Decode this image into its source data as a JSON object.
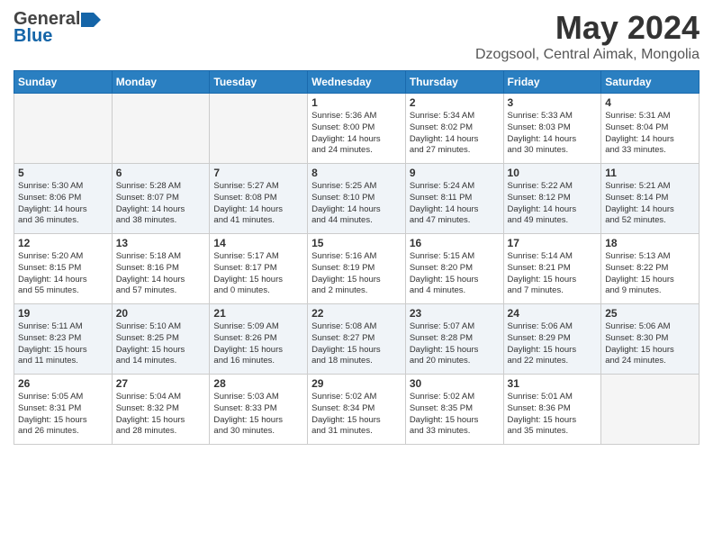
{
  "header": {
    "logo_general": "General",
    "logo_blue": "Blue",
    "month_title": "May 2024",
    "subtitle": "Dzogsool, Central Aimak, Mongolia"
  },
  "weekdays": [
    "Sunday",
    "Monday",
    "Tuesday",
    "Wednesday",
    "Thursday",
    "Friday",
    "Saturday"
  ],
  "weeks": [
    [
      {
        "day": "",
        "info": ""
      },
      {
        "day": "",
        "info": ""
      },
      {
        "day": "",
        "info": ""
      },
      {
        "day": "1",
        "info": "Sunrise: 5:36 AM\nSunset: 8:00 PM\nDaylight: 14 hours\nand 24 minutes."
      },
      {
        "day": "2",
        "info": "Sunrise: 5:34 AM\nSunset: 8:02 PM\nDaylight: 14 hours\nand 27 minutes."
      },
      {
        "day": "3",
        "info": "Sunrise: 5:33 AM\nSunset: 8:03 PM\nDaylight: 14 hours\nand 30 minutes."
      },
      {
        "day": "4",
        "info": "Sunrise: 5:31 AM\nSunset: 8:04 PM\nDaylight: 14 hours\nand 33 minutes."
      }
    ],
    [
      {
        "day": "5",
        "info": "Sunrise: 5:30 AM\nSunset: 8:06 PM\nDaylight: 14 hours\nand 36 minutes."
      },
      {
        "day": "6",
        "info": "Sunrise: 5:28 AM\nSunset: 8:07 PM\nDaylight: 14 hours\nand 38 minutes."
      },
      {
        "day": "7",
        "info": "Sunrise: 5:27 AM\nSunset: 8:08 PM\nDaylight: 14 hours\nand 41 minutes."
      },
      {
        "day": "8",
        "info": "Sunrise: 5:25 AM\nSunset: 8:10 PM\nDaylight: 14 hours\nand 44 minutes."
      },
      {
        "day": "9",
        "info": "Sunrise: 5:24 AM\nSunset: 8:11 PM\nDaylight: 14 hours\nand 47 minutes."
      },
      {
        "day": "10",
        "info": "Sunrise: 5:22 AM\nSunset: 8:12 PM\nDaylight: 14 hours\nand 49 minutes."
      },
      {
        "day": "11",
        "info": "Sunrise: 5:21 AM\nSunset: 8:14 PM\nDaylight: 14 hours\nand 52 minutes."
      }
    ],
    [
      {
        "day": "12",
        "info": "Sunrise: 5:20 AM\nSunset: 8:15 PM\nDaylight: 14 hours\nand 55 minutes."
      },
      {
        "day": "13",
        "info": "Sunrise: 5:18 AM\nSunset: 8:16 PM\nDaylight: 14 hours\nand 57 minutes."
      },
      {
        "day": "14",
        "info": "Sunrise: 5:17 AM\nSunset: 8:17 PM\nDaylight: 15 hours\nand 0 minutes."
      },
      {
        "day": "15",
        "info": "Sunrise: 5:16 AM\nSunset: 8:19 PM\nDaylight: 15 hours\nand 2 minutes."
      },
      {
        "day": "16",
        "info": "Sunrise: 5:15 AM\nSunset: 8:20 PM\nDaylight: 15 hours\nand 4 minutes."
      },
      {
        "day": "17",
        "info": "Sunrise: 5:14 AM\nSunset: 8:21 PM\nDaylight: 15 hours\nand 7 minutes."
      },
      {
        "day": "18",
        "info": "Sunrise: 5:13 AM\nSunset: 8:22 PM\nDaylight: 15 hours\nand 9 minutes."
      }
    ],
    [
      {
        "day": "19",
        "info": "Sunrise: 5:11 AM\nSunset: 8:23 PM\nDaylight: 15 hours\nand 11 minutes."
      },
      {
        "day": "20",
        "info": "Sunrise: 5:10 AM\nSunset: 8:25 PM\nDaylight: 15 hours\nand 14 minutes."
      },
      {
        "day": "21",
        "info": "Sunrise: 5:09 AM\nSunset: 8:26 PM\nDaylight: 15 hours\nand 16 minutes."
      },
      {
        "day": "22",
        "info": "Sunrise: 5:08 AM\nSunset: 8:27 PM\nDaylight: 15 hours\nand 18 minutes."
      },
      {
        "day": "23",
        "info": "Sunrise: 5:07 AM\nSunset: 8:28 PM\nDaylight: 15 hours\nand 20 minutes."
      },
      {
        "day": "24",
        "info": "Sunrise: 5:06 AM\nSunset: 8:29 PM\nDaylight: 15 hours\nand 22 minutes."
      },
      {
        "day": "25",
        "info": "Sunrise: 5:06 AM\nSunset: 8:30 PM\nDaylight: 15 hours\nand 24 minutes."
      }
    ],
    [
      {
        "day": "26",
        "info": "Sunrise: 5:05 AM\nSunset: 8:31 PM\nDaylight: 15 hours\nand 26 minutes."
      },
      {
        "day": "27",
        "info": "Sunrise: 5:04 AM\nSunset: 8:32 PM\nDaylight: 15 hours\nand 28 minutes."
      },
      {
        "day": "28",
        "info": "Sunrise: 5:03 AM\nSunset: 8:33 PM\nDaylight: 15 hours\nand 30 minutes."
      },
      {
        "day": "29",
        "info": "Sunrise: 5:02 AM\nSunset: 8:34 PM\nDaylight: 15 hours\nand 31 minutes."
      },
      {
        "day": "30",
        "info": "Sunrise: 5:02 AM\nSunset: 8:35 PM\nDaylight: 15 hours\nand 33 minutes."
      },
      {
        "day": "31",
        "info": "Sunrise: 5:01 AM\nSunset: 8:36 PM\nDaylight: 15 hours\nand 35 minutes."
      },
      {
        "day": "",
        "info": ""
      }
    ]
  ]
}
